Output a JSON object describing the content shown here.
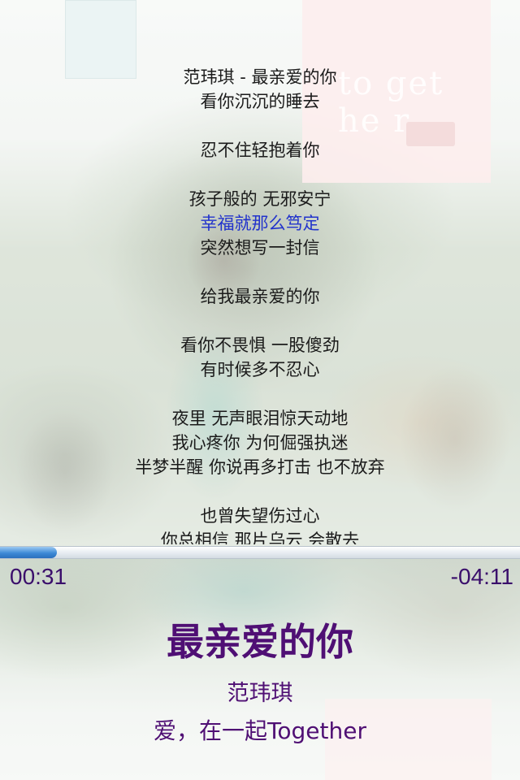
{
  "lyrics": [
    "范玮琪 - 最亲爱的你",
    "看你沉沉的睡去",
    "",
    "忍不住轻抱着你",
    "",
    "孩子般的 无邪安宁",
    "幸福就那么笃定",
    "突然想写一封信",
    "",
    "给我最亲爱的你",
    "",
    "看你不畏惧 一股傻劲",
    "有时候多不忍心",
    "",
    "夜里 无声眼泪惊天动地",
    "我心疼你 为何倔强执迷",
    "半梦半醒 你说再多打击 也不放弃",
    "",
    "也曾失望伤过心",
    "你总相信 那片乌云 会散去"
  ],
  "active_lyric_index": 6,
  "player": {
    "time_elapsed": "00:31",
    "time_remaining": "-04:11",
    "progress_fraction": 0.11
  },
  "track": {
    "title": "最亲爱的你",
    "artist": "范玮琪",
    "album": "爱，在一起Together"
  },
  "cover_art": {
    "logo_text": "to get he r"
  },
  "colors": {
    "lyric_text": "#1b1b1b",
    "lyric_active": "#2233cc",
    "info_text": "#4f0f74",
    "time_text": "#3a0e6b",
    "progress_fill": "#3e8ad6"
  }
}
